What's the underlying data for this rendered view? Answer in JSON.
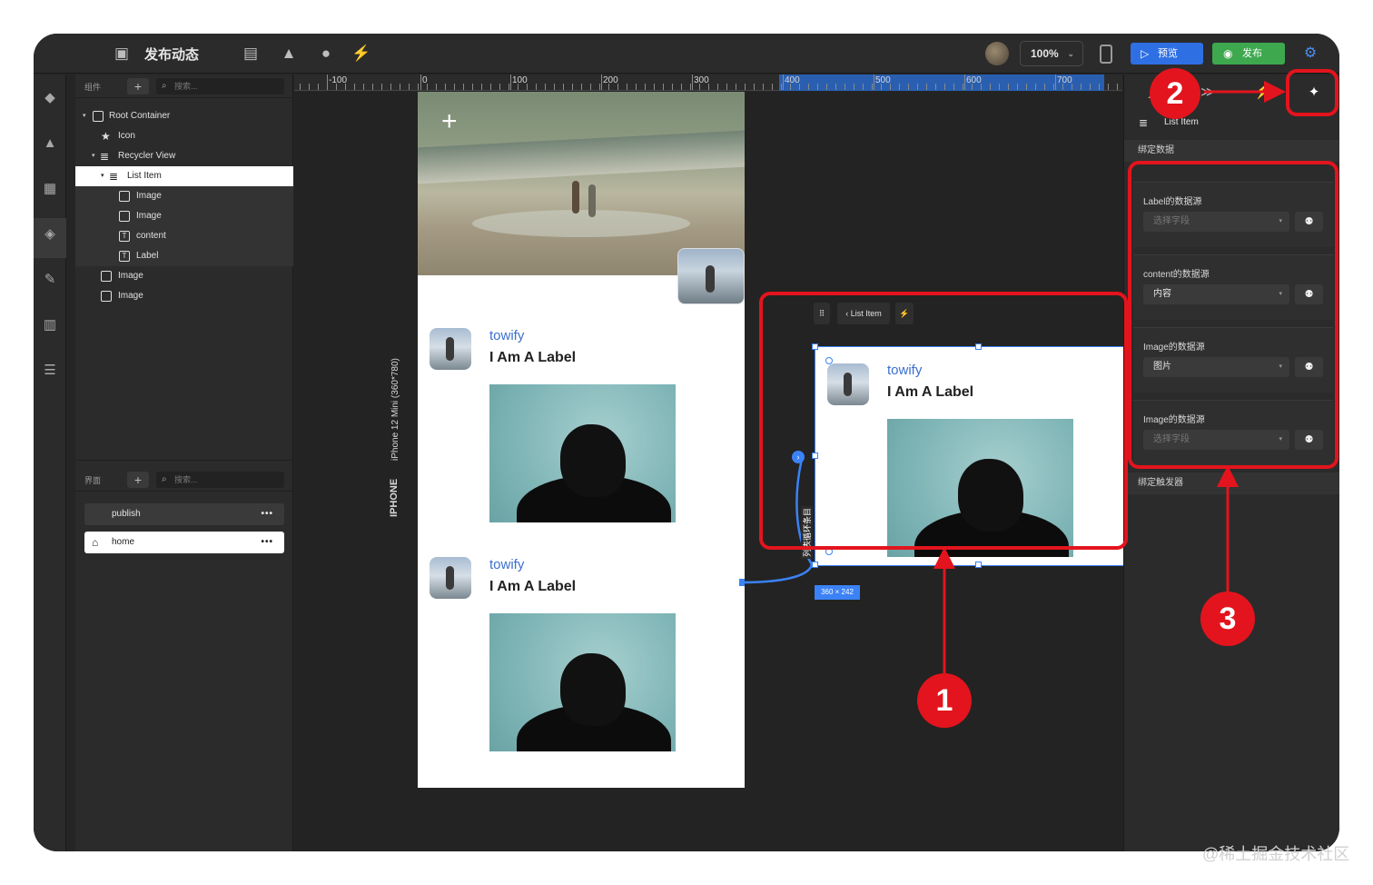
{
  "app": {
    "title": "发布动态",
    "zoom": "100%",
    "preview_label": "预览",
    "publish_label": "发布"
  },
  "components_panel": {
    "header_label": "组件",
    "search_placeholder": "搜索...",
    "tree": [
      {
        "label": "Root Container",
        "icon": "square-icon"
      },
      {
        "label": "Icon",
        "icon": "star-icon"
      },
      {
        "label": "Recycler View",
        "icon": "stack-icon"
      },
      {
        "label": "List Item",
        "icon": "stack-icon"
      },
      {
        "label": "Image",
        "icon": "image-icon"
      },
      {
        "label": "Image",
        "icon": "image-icon"
      },
      {
        "label": "content",
        "icon": "text-icon"
      },
      {
        "label": "Label",
        "icon": "text-icon"
      },
      {
        "label": "Image",
        "icon": "image-icon"
      },
      {
        "label": "Image",
        "icon": "image-icon"
      }
    ]
  },
  "pages_panel": {
    "header_label": "界面",
    "search_placeholder": "搜索...",
    "pages": [
      {
        "label": "publish",
        "more": "•••"
      },
      {
        "label": "home",
        "more": "•••"
      }
    ]
  },
  "ruler": {
    "marks": [
      "-100",
      "0",
      "100",
      "200",
      "300",
      "400",
      "500",
      "600",
      "700"
    ]
  },
  "canvas": {
    "device_label": "iPhone 12 Mini (360*780)",
    "device_type": "IPHONE",
    "cards": [
      {
        "name": "towify",
        "label": "I Am A Label"
      },
      {
        "name": "towify",
        "label": "I Am A Label"
      }
    ],
    "selected_card": {
      "name": "towify",
      "label": "I Am A Label"
    },
    "selection_toolbar_label": "List Item",
    "size_tag": "360 × 242",
    "loop_label": "列表循环条目"
  },
  "right_panel": {
    "component_name": "List Item",
    "bind_data_label": "绑定数据",
    "bind_trigger_label": "绑定触发器",
    "bindings": [
      {
        "label": "Label的数据源",
        "value": "选择字段",
        "empty": true
      },
      {
        "label": "content的数据源",
        "value": "内容",
        "empty": false
      },
      {
        "label": "Image的数据源",
        "value": "图片",
        "empty": false
      },
      {
        "label": "Image的数据源",
        "value": "选择字段",
        "empty": true
      }
    ]
  },
  "annotations": {
    "badge_1": "1",
    "badge_2": "2",
    "badge_3": "3",
    "color": "#e3141d"
  },
  "watermark": "@稀土掘金技术社区"
}
